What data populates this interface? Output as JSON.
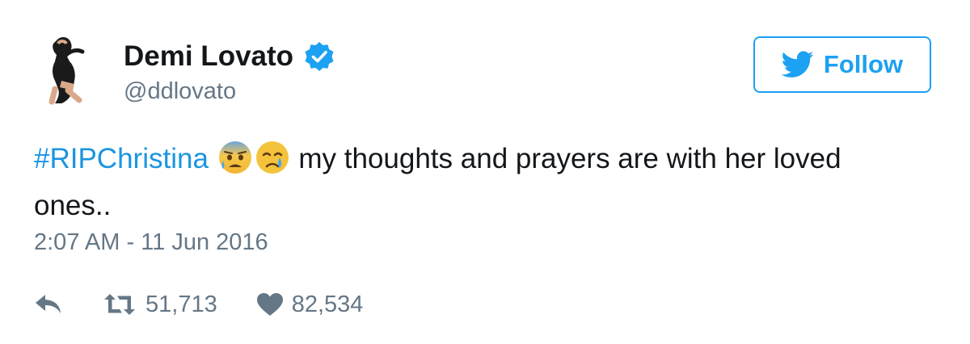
{
  "tweet": {
    "author": {
      "name": "Demi Lovato",
      "handle": "@ddlovato",
      "verified": true,
      "avatar_icon": "profile-photo"
    },
    "follow_button": {
      "label": "Follow",
      "icon": "twitter-bird-icon"
    },
    "text": {
      "hashtag": "#RIPChristina",
      "emojis": [
        "anxious-face-with-sweat",
        "crying-face"
      ],
      "body": " my thoughts and prayers are with her loved ones.."
    },
    "timestamp": "2:07 AM - 11 Jun 2016",
    "actions": {
      "reply_icon": "reply-icon",
      "retweet_count": "51,713",
      "like_count": "82,534"
    }
  },
  "colors": {
    "accent": "#1da1f2",
    "hashtag": "#1b95e0",
    "secondary_text": "#657786",
    "primary_text": "#14171a"
  }
}
